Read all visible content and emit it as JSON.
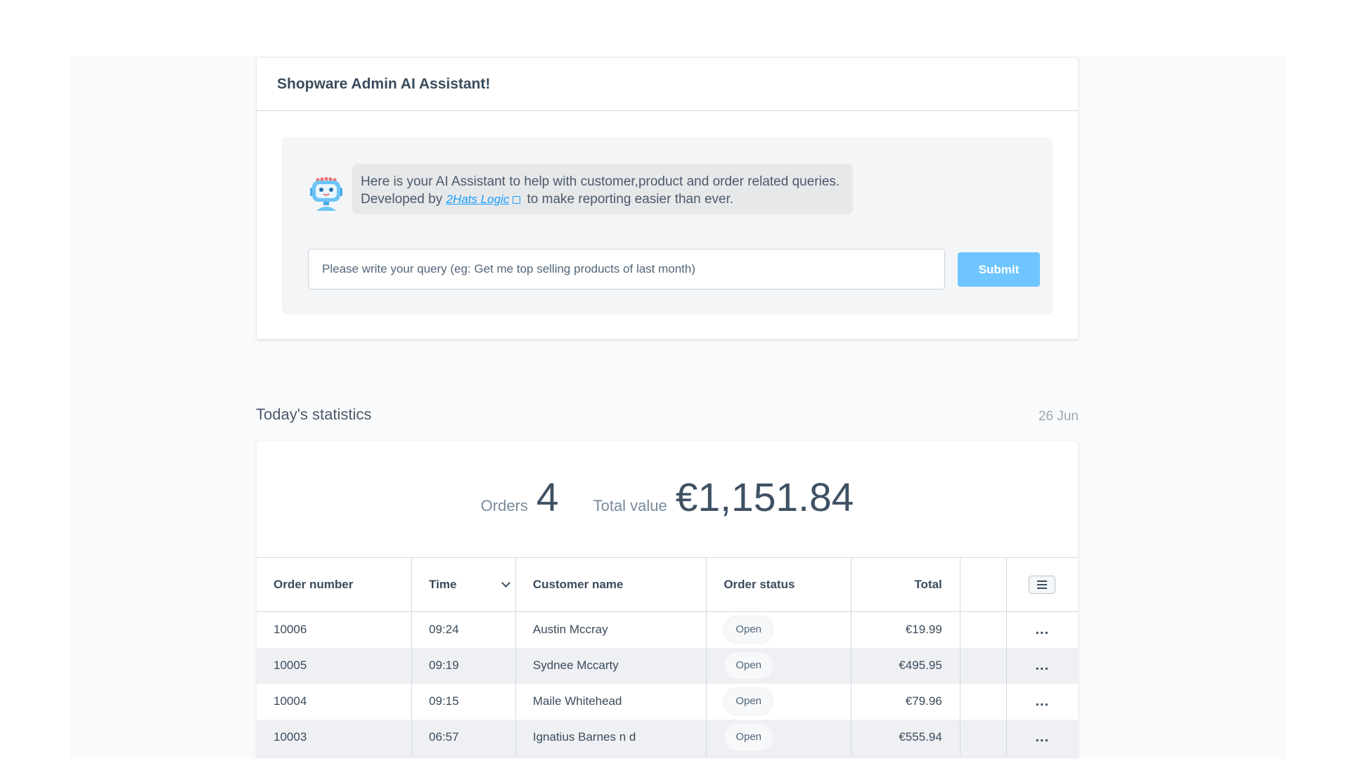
{
  "assistant": {
    "title": "Shopware Admin AI Assistant!",
    "message_before_link": "Here is your AI Assistant to help with customer,product and order related queries. Developed by ",
    "link_text": "2Hats Logic",
    "message_after_link": " to make reporting easier than ever.",
    "query_placeholder": "Please write your query (eg: Get me top selling products of last month)",
    "submit_label": "Submit",
    "robot_icon": "robot-icon"
  },
  "stats": {
    "title": "Today's statistics",
    "date": "26 Jun",
    "orders_label": "Orders",
    "orders_count": "4",
    "total_value_label": "Total value",
    "total_value": "€1,151.84"
  },
  "table": {
    "headers": {
      "order_number": "Order number",
      "time": "Time",
      "customer_name": "Customer name",
      "order_status": "Order status",
      "total": "Total"
    },
    "rows": [
      {
        "order_number": "10006",
        "time": "09:24",
        "customer": "Austin Mccray",
        "status": "Open",
        "total": "€19.99",
        "actions": "..."
      },
      {
        "order_number": "10005",
        "time": "09:19",
        "customer": "Sydnee Mccarty",
        "status": "Open",
        "total": "€495.95",
        "actions": "..."
      },
      {
        "order_number": "10004",
        "time": "09:15",
        "customer": "Maile Whitehead",
        "status": "Open",
        "total": "€79.96",
        "actions": "..."
      },
      {
        "order_number": "10003",
        "time": "06:57",
        "customer": "Ignatius Barnes n d",
        "status": "Open",
        "total": "€555.94",
        "actions": "..."
      }
    ]
  },
  "colors": {
    "accent": "#189eff",
    "submit_bg": "#6fc5ff"
  }
}
